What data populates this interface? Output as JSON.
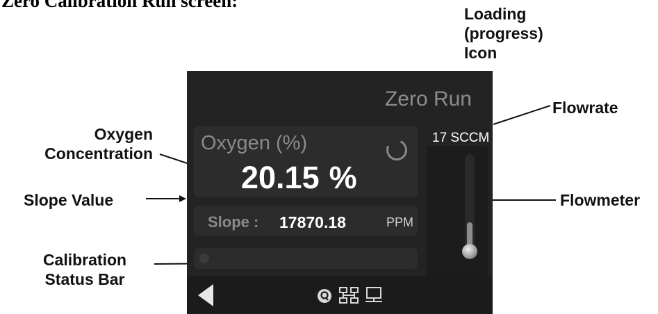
{
  "heading": "Zero Calibration Run screen:",
  "annotations": {
    "loading": [
      "Loading",
      "(progress)",
      "Icon"
    ],
    "flowrate": "Flowrate",
    "oxygen": [
      "Oxygen",
      "Concentration"
    ],
    "flowmeter": "Flowmeter",
    "slope": "Slope Value",
    "calibration": [
      "Calibration",
      "Status Bar"
    ]
  },
  "screen": {
    "title": "Zero Run",
    "oxygen_label": "Oxygen (%)",
    "oxygen_value": "20.15",
    "oxygen_unit": "%",
    "slope_label": "Slope :",
    "slope_value": "17870.18",
    "slope_unit": "PPM",
    "flow_label": "17 SCCM",
    "flowmeter_fill_fraction": 0.3,
    "calibration_progress": 0.0
  },
  "icons": {
    "loading": "spinner-icon",
    "back": "back-arrow-icon",
    "q": "q-badge-icon",
    "network": "network-icon",
    "monitor": "monitor-icon"
  },
  "colors": {
    "screen_bg": "#232323",
    "panel_bg": "#2c2c2c",
    "text_dim": "#8c8c8c",
    "text_bright": "#ffffff"
  }
}
